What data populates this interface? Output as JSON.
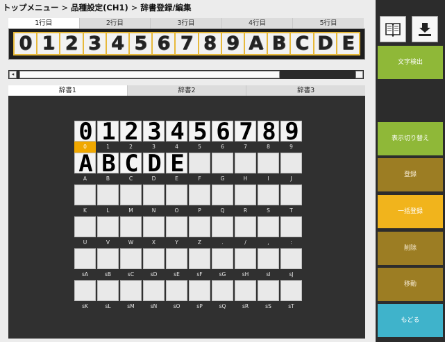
{
  "breadcrumb": {
    "items": [
      "トップメニュー",
      "品種設定(CH1)",
      "辞書登録/編集"
    ],
    "separator": ">"
  },
  "line_tabs": {
    "items": [
      "1行目",
      "2行目",
      "3行目",
      "4行目",
      "5行目"
    ],
    "active_index": 0
  },
  "strip": {
    "characters": [
      "0",
      "1",
      "2",
      "3",
      "4",
      "5",
      "6",
      "7",
      "8",
      "9",
      "A",
      "B",
      "C",
      "D",
      "E"
    ],
    "highlight_color": "#e7b93a"
  },
  "dict_tabs": {
    "items": [
      "辞書1",
      "辞書2",
      "辞書3"
    ],
    "active_index": 0
  },
  "dictionary": {
    "selected": "0",
    "selected_color": "#f0a800",
    "rows": [
      [
        {
          "label": "0",
          "glyph": "0"
        },
        {
          "label": "1",
          "glyph": "1"
        },
        {
          "label": "2",
          "glyph": "2"
        },
        {
          "label": "3",
          "glyph": "3"
        },
        {
          "label": "4",
          "glyph": "4"
        },
        {
          "label": "5",
          "glyph": "5"
        },
        {
          "label": "6",
          "glyph": "6"
        },
        {
          "label": "7",
          "glyph": "7"
        },
        {
          "label": "8",
          "glyph": "8"
        },
        {
          "label": "9",
          "glyph": "9"
        }
      ],
      [
        {
          "label": "A",
          "glyph": "A"
        },
        {
          "label": "B",
          "glyph": "B"
        },
        {
          "label": "C",
          "glyph": "C"
        },
        {
          "label": "D",
          "glyph": "D"
        },
        {
          "label": "E",
          "glyph": "E"
        },
        {
          "label": "F",
          "glyph": ""
        },
        {
          "label": "G",
          "glyph": ""
        },
        {
          "label": "H",
          "glyph": ""
        },
        {
          "label": "I",
          "glyph": ""
        },
        {
          "label": "J",
          "glyph": ""
        }
      ],
      [
        {
          "label": "K",
          "glyph": ""
        },
        {
          "label": "L",
          "glyph": ""
        },
        {
          "label": "M",
          "glyph": ""
        },
        {
          "label": "N",
          "glyph": ""
        },
        {
          "label": "O",
          "glyph": ""
        },
        {
          "label": "P",
          "glyph": ""
        },
        {
          "label": "Q",
          "glyph": ""
        },
        {
          "label": "R",
          "glyph": ""
        },
        {
          "label": "S",
          "glyph": ""
        },
        {
          "label": "T",
          "glyph": ""
        }
      ],
      [
        {
          "label": "U",
          "glyph": ""
        },
        {
          "label": "V",
          "glyph": ""
        },
        {
          "label": "W",
          "glyph": ""
        },
        {
          "label": "X",
          "glyph": ""
        },
        {
          "label": "Y",
          "glyph": ""
        },
        {
          "label": "Z",
          "glyph": ""
        },
        {
          "label": ".",
          "glyph": ""
        },
        {
          "label": "/",
          "glyph": ""
        },
        {
          "label": ",",
          "glyph": ""
        },
        {
          "label": ":",
          "glyph": ""
        }
      ],
      [
        {
          "label": "sA",
          "glyph": ""
        },
        {
          "label": "sB",
          "glyph": ""
        },
        {
          "label": "sC",
          "glyph": ""
        },
        {
          "label": "sD",
          "glyph": ""
        },
        {
          "label": "sE",
          "glyph": ""
        },
        {
          "label": "sF",
          "glyph": ""
        },
        {
          "label": "sG",
          "glyph": ""
        },
        {
          "label": "sH",
          "glyph": ""
        },
        {
          "label": "sI",
          "glyph": ""
        },
        {
          "label": "sJ",
          "glyph": ""
        }
      ],
      [
        {
          "label": "sK",
          "glyph": ""
        },
        {
          "label": "sL",
          "glyph": ""
        },
        {
          "label": "sM",
          "glyph": ""
        },
        {
          "label": "sN",
          "glyph": ""
        },
        {
          "label": "sO",
          "glyph": ""
        },
        {
          "label": "sP",
          "glyph": ""
        },
        {
          "label": "sQ",
          "glyph": ""
        },
        {
          "label": "sR",
          "glyph": ""
        },
        {
          "label": "sS",
          "glyph": ""
        },
        {
          "label": "sT",
          "glyph": ""
        }
      ]
    ]
  },
  "right_panel": {
    "icons": [
      "book-icon",
      "download-icon"
    ],
    "buttons": {
      "detect": "文字検出",
      "toggle_display": "表示切り替え",
      "register": "登録",
      "bulk_register": "一括登録",
      "delete": "削除",
      "move": "移動",
      "back": "もどる"
    },
    "colors": {
      "green": "#8fb838",
      "brown": "#9c7d23",
      "yellow": "#f1b41c",
      "cyan": "#3fb3cb"
    }
  }
}
